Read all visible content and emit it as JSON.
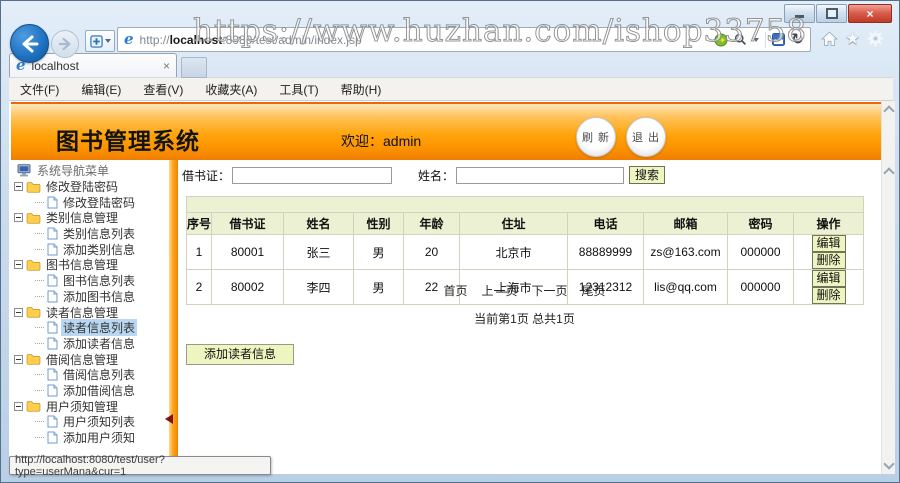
{
  "watermark_text": "https://www.huzhan.com/ishop33758",
  "browser": {
    "tab_title": "localhost",
    "url_prefix": "http://",
    "url_host": "localhost",
    "url_path": ":8080/test/admin/index.jsp",
    "menu": [
      "文件(F)",
      "编辑(E)",
      "查看(V)",
      "收藏夹(A)",
      "工具(T)",
      "帮助(H)"
    ],
    "status_text": "http://localhost:8080/test/user?type=userMana&cur=1",
    "icons": {
      "close_glyph": "×",
      "tab_close_glyph": "×",
      "refresh_glyph": "↻",
      "star_glyph": "★"
    }
  },
  "header": {
    "app_title": "图书管理系统",
    "welcome_text": "欢迎：admin",
    "refresh_button": "刷 新",
    "logout_button": "退 出"
  },
  "sidebar": {
    "root_label": "系统导航菜单",
    "selected_item": "读者信息列表",
    "sections": [
      {
        "label": "修改登陆密码",
        "children": [
          "修改登陆密码"
        ]
      },
      {
        "label": "类别信息管理",
        "children": [
          "类别信息列表",
          "添加类别信息"
        ]
      },
      {
        "label": "图书信息管理",
        "children": [
          "图书信息列表",
          "添加图书信息"
        ]
      },
      {
        "label": "读者信息管理",
        "children": [
          "读者信息列表",
          "添加读者信息"
        ]
      },
      {
        "label": "借阅信息管理",
        "children": [
          "借阅信息列表",
          "添加借阅信息"
        ]
      },
      {
        "label": "用户须知管理",
        "children": [
          "用户须知列表",
          "添加用户须知"
        ]
      }
    ]
  },
  "content": {
    "search": {
      "card_label": "借书证：",
      "card_value": "",
      "name_label": "姓名：",
      "name_value": "",
      "search_button": "搜索"
    },
    "table": {
      "headers": [
        "序号",
        "借书证",
        "姓名",
        "性别",
        "年龄",
        "住址",
        "电话",
        "邮箱",
        "密码",
        "操作"
      ],
      "rows": [
        {
          "seq": "1",
          "card": "80001",
          "name": "张三",
          "gender": "男",
          "age": "20",
          "address": "北京市",
          "phone": "88889999",
          "email": "zs@163.com",
          "password": "000000",
          "edit": "编辑",
          "delete": "删除"
        },
        {
          "seq": "2",
          "card": "80002",
          "name": "李四",
          "gender": "男",
          "age": "22",
          "address": "上海市",
          "phone": "12312312",
          "email": "lis@qq.com",
          "password": "000000",
          "edit": "编辑",
          "delete": "删除"
        }
      ]
    },
    "pagination": {
      "first": "首页",
      "prev": "上一页",
      "next": "下一页",
      "last": "尾页",
      "status": "当前第1页 总共1页"
    },
    "add_reader_button": "添加读者信息"
  },
  "colors": {
    "header_orange": "#FFA40B",
    "button_yellow": "#EFF5C0",
    "selected_blue": "#B9D7F1",
    "close_red": "#C03A28"
  }
}
